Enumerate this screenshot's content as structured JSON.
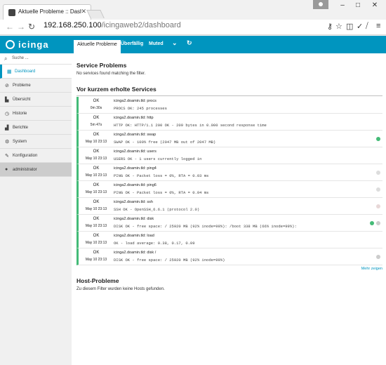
{
  "browser": {
    "tab_title": "Aktuelle Probleme :: Dashb",
    "url_domain": "192.168.250.100",
    "url_path": "/icingaweb2/dashboard",
    "window_controls": [
      "–",
      "□",
      "✕"
    ]
  },
  "app": {
    "logo": "icinga",
    "tabs": [
      "Aktuelle Probleme",
      "Überfällig",
      "Muted",
      "⌄",
      "↻"
    ]
  },
  "sidebar": {
    "search_placeholder": "Suche ...",
    "items": [
      {
        "label": "Dashboard",
        "icon": "dashboard-icon",
        "glyph": "▦"
      },
      {
        "label": "Probleme",
        "icon": "problems-icon",
        "glyph": "⊘"
      },
      {
        "label": "Übersicht",
        "icon": "overview-icon",
        "glyph": "▙"
      },
      {
        "label": "Historie",
        "icon": "history-icon",
        "glyph": "◷"
      },
      {
        "label": "Berichte",
        "icon": "reports-icon",
        "glyph": "▟"
      },
      {
        "label": "System",
        "icon": "system-icon",
        "glyph": "⚙"
      },
      {
        "label": "Konfiguration",
        "icon": "wrench-icon",
        "glyph": "✎"
      },
      {
        "label": "administrator",
        "icon": "user-icon",
        "glyph": "●"
      }
    ]
  },
  "main": {
    "service_problems_title": "Service Problems",
    "service_problems_note": "No services found matching the filter.",
    "recovered_title": "Vor kurzem erholte Services",
    "rows": [
      {
        "state": "OK",
        "time": "0m 30s",
        "name": "icinga2.doamin.tld: procs",
        "output": "PROCS OK: 245 processes",
        "dots": []
      },
      {
        "state": "OK",
        "time": "5m 47s",
        "name": "icinga2.doamin.tld: http",
        "output": "HTTP OK: HTTP/1.1 200 OK - 209 bytes in 0.000 second response time",
        "dots": []
      },
      {
        "state": "OK",
        "time": "May 10 23:13",
        "name": "icinga2.doamin.tld: swap",
        "output": "SWAP OK - 100% free (2047 MB out of 2047 MB)",
        "dots": [
          "#44bb77"
        ]
      },
      {
        "state": "OK",
        "time": "May 10 23:13",
        "name": "icinga2.doamin.tld: users",
        "output": "USERS OK - 1 users currently logged in",
        "dots": []
      },
      {
        "state": "OK",
        "time": "May 10 23:13",
        "name": "icinga2.doamin.tld: ping4",
        "output": "PING OK - Packet loss = 0%, RTA = 0.03 ms",
        "dots": [
          "#dddddd"
        ]
      },
      {
        "state": "OK",
        "time": "May 10 23:13",
        "name": "icinga2.doamin.tld: ping6",
        "output": "PING OK - Packet loss = 0%, RTA = 0.04 ms",
        "dots": [
          "#dddddd"
        ]
      },
      {
        "state": "OK",
        "time": "May 10 23:13",
        "name": "icinga2.doamin.tld: ssh",
        "output": "SSH OK - OpenSSH_6.6.1 (protocol 2.0)",
        "dots": [
          "#e8d8d8"
        ]
      },
      {
        "state": "OK",
        "time": "May 10 23:13",
        "name": "icinga2.doamin.tld: disk",
        "output": "DISK OK - free space: / 25920 MB (92% inode=99%): /boot 338 MB (66% inode=99%):",
        "dots": [
          "#44bb77",
          "#cccccc"
        ]
      },
      {
        "state": "OK",
        "time": "May 10 23:13",
        "name": "icinga2.doamin.tld: load",
        "output": "OK - load average: 0.38, 0.17, 0.09",
        "dots": []
      },
      {
        "state": "OK",
        "time": "May 10 23:13",
        "name": "icinga2.doamin.tld: disk /",
        "output": "DISK OK - free space: / 25920 MB (92% inode=99%)",
        "dots": [
          "#cccccc"
        ]
      }
    ],
    "show_more": "Mehr zeigen",
    "host_problems_title": "Host-Probleme",
    "host_problems_note": "Zu diesem Filter wurden keine Hosts gefunden."
  }
}
